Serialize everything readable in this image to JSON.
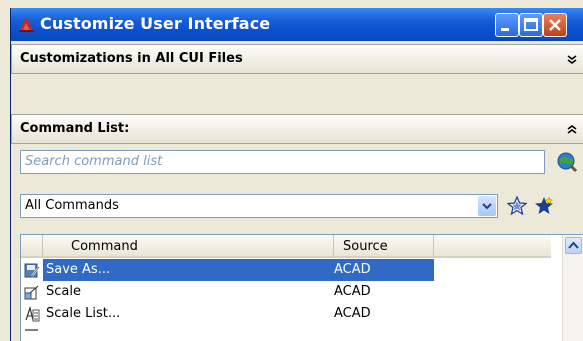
{
  "window": {
    "title": "Customize User Interface",
    "buttons": {
      "minimize": "minimize",
      "maximize": "maximize",
      "close": "close"
    }
  },
  "sections": {
    "customizations": {
      "label": "Customizations in All CUI Files",
      "state": "collapsed"
    },
    "command_list": {
      "label": "Command List:",
      "state": "expanded"
    }
  },
  "search": {
    "placeholder": "Search command list",
    "value": ""
  },
  "filter": {
    "selected": "All Commands"
  },
  "table": {
    "columns": [
      "Command",
      "Source"
    ],
    "rows": [
      {
        "command": "Save As...",
        "source": "ACAD",
        "icon": "save-as-icon",
        "selected": true
      },
      {
        "command": "Scale",
        "source": "ACAD",
        "icon": "scale-icon",
        "selected": false
      },
      {
        "command": "Scale List...",
        "source": "ACAD",
        "icon": "scale-list-icon",
        "selected": false
      }
    ]
  },
  "colors": {
    "titlebar": "#0a4fcf",
    "selection": "#316ac5",
    "close_button": "#c23e17"
  }
}
